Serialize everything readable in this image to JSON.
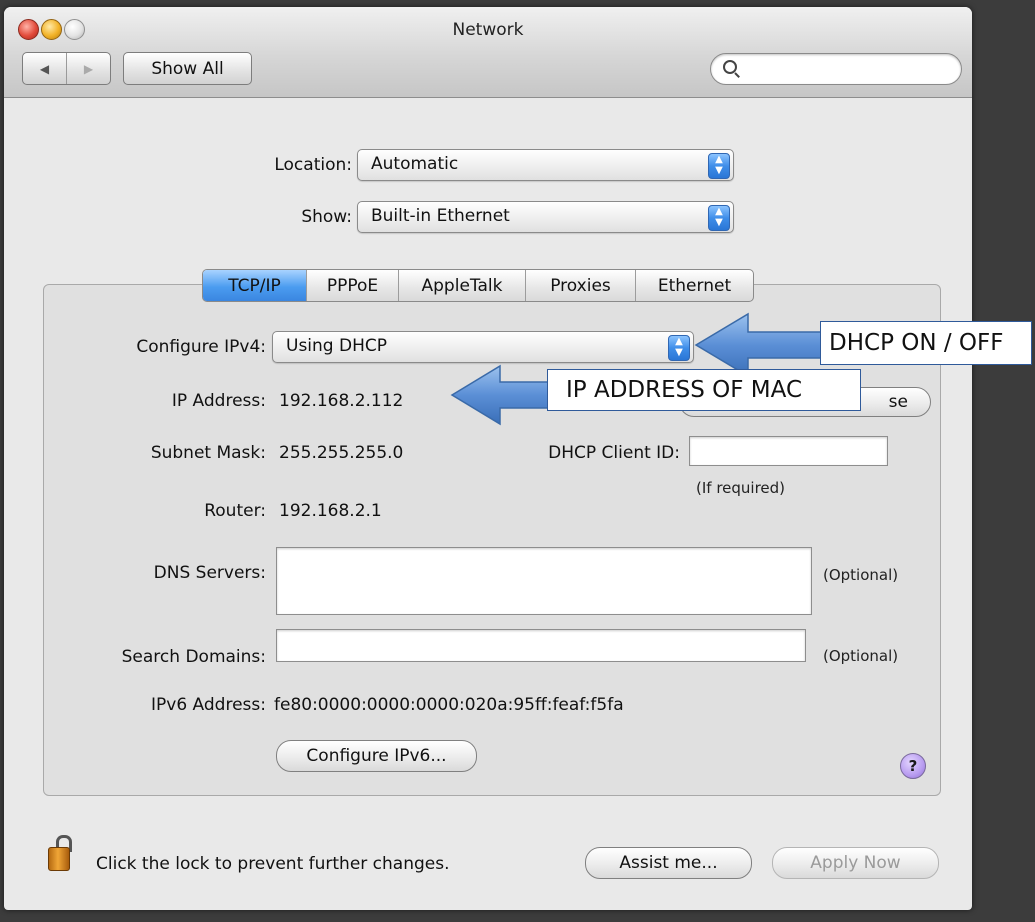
{
  "window": {
    "title": "Network"
  },
  "toolbar": {
    "back": "◀",
    "forward": "▶",
    "show_all_label": "Show All",
    "search_placeholder": ""
  },
  "location": {
    "label": "Location:",
    "value": "Automatic"
  },
  "show": {
    "label": "Show:",
    "value": "Built-in Ethernet"
  },
  "tabs": [
    {
      "label": "TCP/IP",
      "active": true
    },
    {
      "label": "PPPoE",
      "active": false
    },
    {
      "label": "AppleTalk",
      "active": false
    },
    {
      "label": "Proxies",
      "active": false
    },
    {
      "label": "Ethernet",
      "active": false
    }
  ],
  "tcpip": {
    "configure_label": "Configure IPv4:",
    "configure_value": "Using DHCP",
    "ip_label": "IP Address:",
    "ip_value": "192.168.2.112",
    "renew_button_visible": "se",
    "subnet_label": "Subnet Mask:",
    "subnet_value": "255.255.255.0",
    "dhcp_client_label": "DHCP Client ID:",
    "dhcp_client_value": "",
    "dhcp_client_hint": "(If required)",
    "router_label": "Router:",
    "router_value": "192.168.2.1",
    "dns_label": "DNS Servers:",
    "dns_value": "",
    "dns_hint": "(Optional)",
    "search_label": "Search Domains:",
    "search_value": "",
    "search_hint": "(Optional)",
    "ipv6_label": "IPv6 Address:",
    "ipv6_value": "fe80:0000:0000:0000:020a:95ff:feaf:f5fa",
    "configure_ipv6_button": "Configure IPv6...",
    "help": "?"
  },
  "footer": {
    "lock_text": "Click the lock to prevent further changes.",
    "assist_button": "Assist me...",
    "apply_button": "Apply Now"
  },
  "annotations": {
    "dhcp": "DHCP ON / OFF",
    "ip": "IP ADDRESS OF MAC"
  },
  "colors": {
    "accent_blue": "#3f8ee9",
    "arrow_blue": "#5b8fd6"
  }
}
